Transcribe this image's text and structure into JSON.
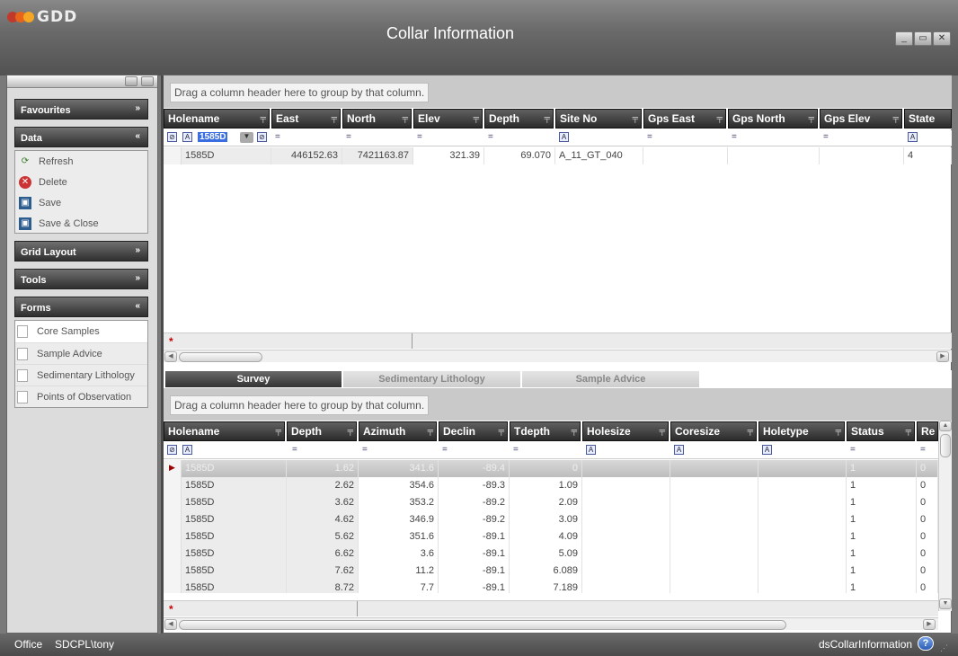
{
  "app": {
    "logo_text": "GDD",
    "title": "Collar Information",
    "btn_min": "_",
    "btn_max": "▭",
    "btn_close": "✕",
    "colors": {
      "logo_red": "#c0392b",
      "logo_orange": "#e8641a",
      "logo_yellow": "#f5a623"
    }
  },
  "sidebar": {
    "favourites": "Favourites",
    "data": "Data",
    "grid_layout": "Grid Layout",
    "tools": "Tools",
    "forms": "Forms",
    "chev_down": "»",
    "chev_up": "«",
    "data_items": [
      {
        "label": "Refresh",
        "icon": "refresh-icon"
      },
      {
        "label": "Delete",
        "icon": "delete-icon"
      },
      {
        "label": "Save",
        "icon": "save-icon"
      },
      {
        "label": "Save & Close",
        "icon": "save-close-icon"
      }
    ],
    "form_items": [
      "Core Samples",
      "Sample Advice",
      "Sedimentary Lithology",
      "Points of Observation"
    ]
  },
  "collar": {
    "group_hint": "Drag a column header here to group by that column.",
    "columns": [
      "Holename",
      "East",
      "North",
      "Elev",
      "Depth",
      "Site No",
      "Gps East",
      "Gps North",
      "Gps Elev",
      "State"
    ],
    "filter_value": "1585D",
    "row": {
      "holename": "1585D",
      "east": "446152.63",
      "north": "7421163.87",
      "elev": "321.39",
      "depth": "69.070",
      "site_no": "A_11_GT_040",
      "state": "4"
    }
  },
  "tabs": [
    "Survey",
    "Sedimentary Lithology",
    "Sample Advice"
  ],
  "survey": {
    "group_hint": "Drag a column header here to group by that column.",
    "columns": [
      "Holename",
      "Depth",
      "Azimuth",
      "Declin",
      "Tdepth",
      "Holesize",
      "Coresize",
      "Holetype",
      "Status",
      "Re"
    ],
    "rows": [
      {
        "holename": "1585D",
        "depth": "1.62",
        "azimuth": "341.6",
        "declin": "-89.4",
        "tdepth": "0",
        "status": "1",
        "re": "0"
      },
      {
        "holename": "1585D",
        "depth": "2.62",
        "azimuth": "354.6",
        "declin": "-89.3",
        "tdepth": "1.09",
        "status": "1",
        "re": "0"
      },
      {
        "holename": "1585D",
        "depth": "3.62",
        "azimuth": "353.2",
        "declin": "-89.2",
        "tdepth": "2.09",
        "status": "1",
        "re": "0"
      },
      {
        "holename": "1585D",
        "depth": "4.62",
        "azimuth": "346.9",
        "declin": "-89.2",
        "tdepth": "3.09",
        "status": "1",
        "re": "0"
      },
      {
        "holename": "1585D",
        "depth": "5.62",
        "azimuth": "351.6",
        "declin": "-89.1",
        "tdepth": "4.09",
        "status": "1",
        "re": "0"
      },
      {
        "holename": "1585D",
        "depth": "6.62",
        "azimuth": "3.6",
        "declin": "-89.1",
        "tdepth": "5.09",
        "status": "1",
        "re": "0"
      },
      {
        "holename": "1585D",
        "depth": "7.62",
        "azimuth": "11.2",
        "declin": "-89.1",
        "tdepth": "6.089",
        "status": "1",
        "re": "0"
      },
      {
        "holename": "1585D",
        "depth": "8.72",
        "azimuth": "7.7",
        "declin": "-89.1",
        "tdepth": "7.189",
        "status": "1",
        "re": "0"
      }
    ]
  },
  "status": {
    "office": "Office",
    "user": "SDCPL\\tony",
    "dataset": "dsCollarInformation",
    "help": "?"
  }
}
